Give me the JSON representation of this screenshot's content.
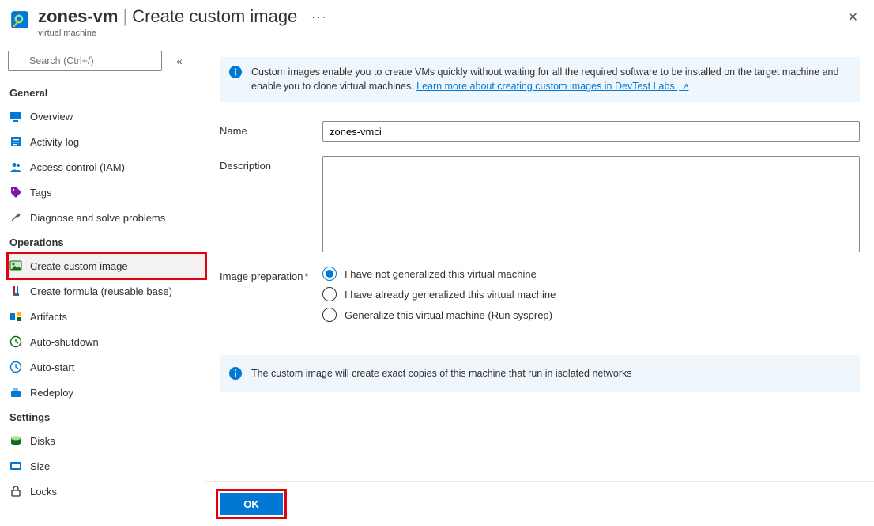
{
  "header": {
    "resource_name": "zones-vm",
    "page_title": "Create custom image",
    "breadcrumb": "virtual machine"
  },
  "search": {
    "placeholder": "Search (Ctrl+/)"
  },
  "sidebar": {
    "groups": [
      {
        "title": "General",
        "items": [
          {
            "key": "overview",
            "label": "Overview",
            "icon": "overview-icon",
            "color": "#0078d4"
          },
          {
            "key": "activity-log",
            "label": "Activity log",
            "icon": "activity-log-icon",
            "color": "#0078d4"
          },
          {
            "key": "access-control",
            "label": "Access control (IAM)",
            "icon": "people-icon",
            "color": "#0078d4"
          },
          {
            "key": "tags",
            "label": "Tags",
            "icon": "tag-icon",
            "color": "#7719aa"
          },
          {
            "key": "diagnose",
            "label": "Diagnose and solve problems",
            "icon": "wrench-icon",
            "color": "#605e5c"
          }
        ]
      },
      {
        "title": "Operations",
        "items": [
          {
            "key": "create-custom-image",
            "label": "Create custom image",
            "icon": "image-icon",
            "color": "#0f6d0f",
            "selected": true
          },
          {
            "key": "create-formula",
            "label": "Create formula (reusable base)",
            "icon": "flask-icon",
            "color": "#a4262c"
          },
          {
            "key": "artifacts",
            "label": "Artifacts",
            "icon": "artifacts-icon",
            "color": "#0078d4"
          },
          {
            "key": "auto-shutdown",
            "label": "Auto-shutdown",
            "icon": "clock-icon",
            "color": "#0f6d0f"
          },
          {
            "key": "auto-start",
            "label": "Auto-start",
            "icon": "clock-start-icon",
            "color": "#0078d4"
          },
          {
            "key": "redeploy",
            "label": "Redeploy",
            "icon": "redeploy-icon",
            "color": "#0078d4"
          }
        ]
      },
      {
        "title": "Settings",
        "items": [
          {
            "key": "disks",
            "label": "Disks",
            "icon": "disk-icon",
            "color": "#0f6d0f"
          },
          {
            "key": "size",
            "label": "Size",
            "icon": "size-icon",
            "color": "#0078d4"
          },
          {
            "key": "locks",
            "label": "Locks",
            "icon": "lock-icon",
            "color": "#323130"
          }
        ]
      }
    ]
  },
  "info_banner_top": {
    "text_before_link": "Custom images enable you to create VMs quickly without waiting for all the required software to be installed on the target machine and enable you to clone virtual machines. ",
    "link_text": "Learn more about creating custom images in DevTest Labs."
  },
  "form": {
    "name_label": "Name",
    "name_value": "zones-vmci",
    "description_label": "Description",
    "description_value": "",
    "image_prep_label": "Image preparation",
    "radios": [
      {
        "key": "not-generalized",
        "label": "I have not generalized this virtual machine",
        "checked": true
      },
      {
        "key": "already-generalized",
        "label": "I have already generalized this virtual machine",
        "checked": false
      },
      {
        "key": "generalize-now",
        "label": "Generalize this virtual machine (Run sysprep)",
        "checked": false
      }
    ]
  },
  "info_banner_bottom": {
    "text": "The custom image will create exact copies of this machine that run in isolated networks"
  },
  "footer": {
    "ok_label": "OK"
  }
}
